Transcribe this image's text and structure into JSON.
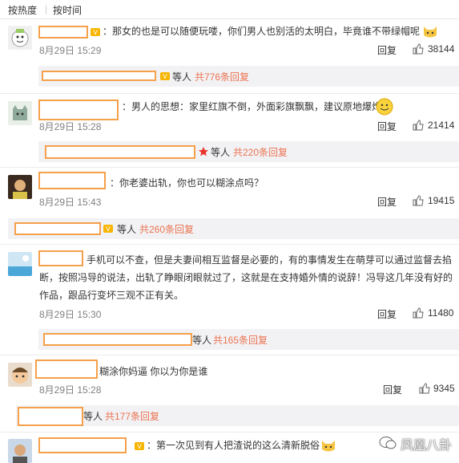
{
  "sort": {
    "by_hot": "按热度",
    "by_time": "按时间"
  },
  "reply_label": "回复",
  "comments": [
    {
      "text": "：那女的也是可以随便玩喽，你们男人也别活的太明白，毕竟谁不带绿帽呢",
      "date": "8月29日 15:29",
      "likes": "38144"
    },
    {
      "text": "：男人的思想：家里红旗不倒，外面彩旗飘飘，建议原地爆炸",
      "date": "8月29日 15:28",
      "likes": "21414"
    },
    {
      "text": "：你老婆出轨，你也可以糊涂点吗？",
      "date": "8月29日 15:43",
      "likes": "19415"
    },
    {
      "text1": "手机可以不查，但是夫妻间相互监督是必要的，有的事情发生在萌芽可以通过监督去掐",
      "text2": "断，按照冯导的说法，出轨了睁眼闭眼就过了，这就是在支持婚外情的说辞！冯导这几年没有好的",
      "text3": "作品，跟品行变坏三观不正有关。",
      "date": "8月29日 15:30",
      "likes": "11480"
    },
    {
      "text": "糊涂你妈逼 你以为你是谁",
      "date": "8月29日 15:28",
      "likes": "9345"
    },
    {
      "text": "：第一次见到有人把渣说的这么清新脱俗"
    }
  ],
  "subs": [
    {
      "who": "等人",
      "count": "共776条回复"
    },
    {
      "who": "等人",
      "count": "共220条回复"
    },
    {
      "who": "等人",
      "count": "共260条回复"
    },
    {
      "who": "等人",
      "count": "共165条回复"
    },
    {
      "who": "等人",
      "count": "共177条回复"
    }
  ],
  "watermark": "凤凰八卦",
  "colors": {
    "accent": "#eb7350",
    "redact_border": "#f5a04a",
    "sub_bg": "#f2f2f5",
    "meta": "#808080"
  }
}
